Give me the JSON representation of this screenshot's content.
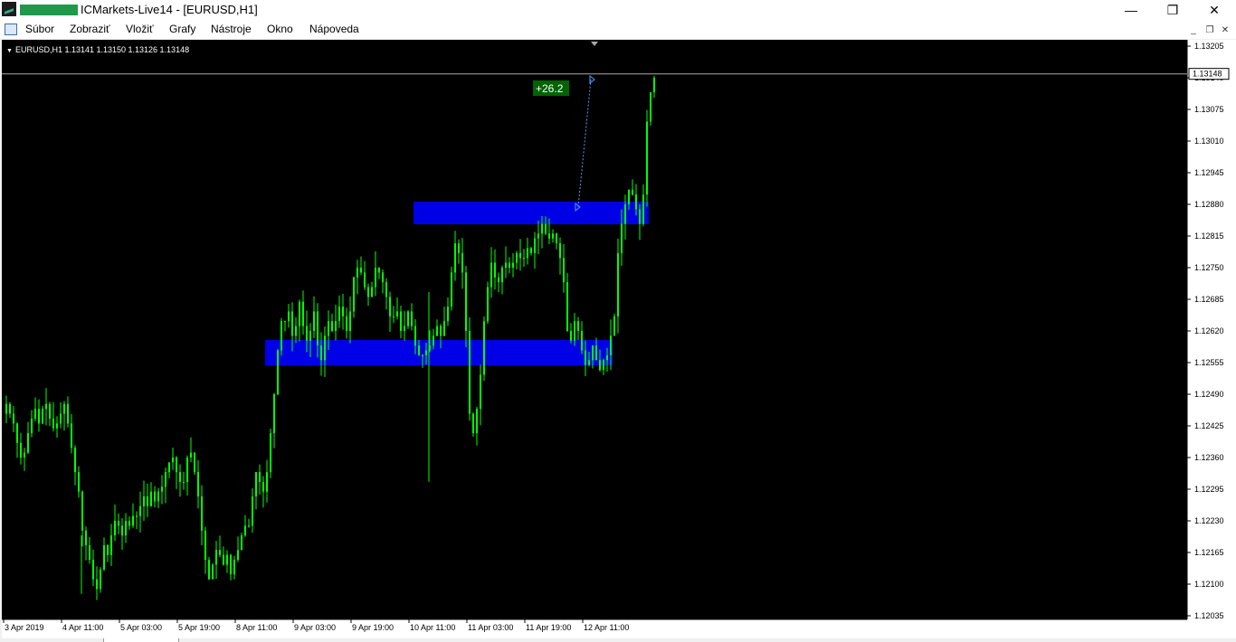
{
  "window": {
    "title": "ICMarkets-Live14 - [EURUSD,H1]",
    "controls": {
      "minimize": "—",
      "restore": "❐",
      "close": "✕"
    }
  },
  "menu": {
    "items": [
      "Súbor",
      "Zobraziť",
      "Vložiť",
      "Grafy",
      "Nástroje",
      "Okno",
      "Nápoveda"
    ],
    "mdi_controls": {
      "minimize": "_",
      "restore": "❐",
      "close": "✕"
    }
  },
  "chart": {
    "symbol_header": "EURUSD,H1  1.13141 1.13150 1.13126 1.13148",
    "current_price": "1.13148",
    "profit_label": "+26.2",
    "colors": {
      "background": "#000000",
      "candles": "#00ff00",
      "zones": "#0000e6",
      "axis_text": "#000000",
      "profit_bg": "#006400"
    }
  },
  "chart_data": {
    "type": "candlestick",
    "y_ticks": [
      "1.13205",
      "1.13140",
      "1.13075",
      "1.13010",
      "1.12945",
      "1.12880",
      "1.12815",
      "1.12750",
      "1.12685",
      "1.12620",
      "1.12555",
      "1.12490",
      "1.12425",
      "1.12360",
      "1.12295",
      "1.12230",
      "1.12165",
      "1.12100",
      "1.12035"
    ],
    "ylim": [
      1.12035,
      1.13205
    ],
    "x_ticks": [
      "3 Apr 2019",
      "4 Apr 11:00",
      "5 Apr 03:00",
      "5 Apr 19:00",
      "8 Apr 11:00",
      "9 Apr 03:00",
      "9 Apr 19:00",
      "10 Apr 11:00",
      "11 Apr 03:00",
      "11 Apr 19:00",
      "12 Apr 11:00"
    ],
    "close_path": [
      1.1247,
      1.1245,
      1.1243,
      1.1239,
      1.1236,
      1.1237,
      1.1241,
      1.1244,
      1.1246,
      1.1243,
      1.1246,
      1.1247,
      1.1244,
      1.1242,
      1.1243,
      1.1245,
      1.1247,
      1.1243,
      1.1238,
      1.1233,
      1.1229,
      1.1221,
      1.1218,
      1.1215,
      1.1211,
      1.1209,
      1.1213,
      1.1218,
      1.1216,
      1.122,
      1.1223,
      1.1222,
      1.122,
      1.1223,
      1.1222,
      1.1224,
      1.1224,
      1.1226,
      1.1228,
      1.1226,
      1.1229,
      1.1227,
      1.1229,
      1.123,
      1.1233,
      1.1235,
      1.1236,
      1.1233,
      1.1231,
      1.1231,
      1.1236,
      1.1237,
      1.1233,
      1.1228,
      1.1221,
      1.1215,
      1.1211,
      1.1214,
      1.1217,
      1.1216,
      1.1214,
      1.1216,
      1.1212,
      1.1215,
      1.1217,
      1.122,
      1.1222,
      1.1222,
      1.1228,
      1.1233,
      1.1231,
      1.1229,
      1.1233,
      1.1241,
      1.1249,
      1.1258,
      1.1264,
      1.1264,
      1.1266,
      1.1261,
      1.1263,
      1.1268,
      1.1263,
      1.126,
      1.1262,
      1.1266,
      1.1259,
      1.1256,
      1.1261,
      1.1264,
      1.1262,
      1.1264,
      1.1267,
      1.1265,
      1.1262,
      1.1266,
      1.1273,
      1.1275,
      1.1274,
      1.1271,
      1.1269,
      1.1271,
      1.1275,
      1.1274,
      1.1272,
      1.1269,
      1.1265,
      1.1265,
      1.1266,
      1.1262,
      1.1263,
      1.1266,
      1.1263,
      1.1259,
      1.1257,
      1.1257,
      1.1258,
      1.1259,
      1.1261,
      1.1263,
      1.1261,
      1.1264,
      1.1267,
      1.1274,
      1.128,
      1.1278,
      1.1274,
      1.1262,
      1.1245,
      1.1241,
      1.1246,
      1.1253,
      1.1264,
      1.1271,
      1.1276,
      1.1273,
      1.1272,
      1.1275,
      1.1276,
      1.1275,
      1.1276,
      1.1278,
      1.1277,
      1.1277,
      1.1279,
      1.1278,
      1.1281,
      1.1282,
      1.1284,
      1.1282,
      1.1281,
      1.1282,
      1.128,
      1.1277,
      1.1272,
      1.1262,
      1.126,
      1.1264,
      1.1262,
      1.1258,
      1.1255,
      1.1256,
      1.1259,
      1.1256,
      1.1254,
      1.1256,
      1.1257,
      1.1261,
      1.1265,
      1.1278,
      1.1284,
      1.1288,
      1.1291,
      1.129,
      1.1287,
      1.1284,
      1.129,
      1.1305,
      1.1311,
      1.1314
    ]
  }
}
